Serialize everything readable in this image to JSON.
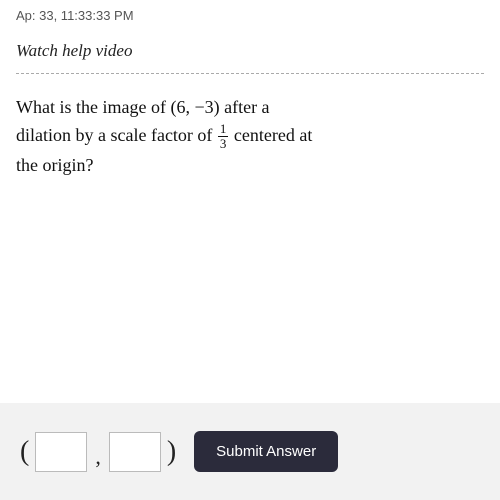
{
  "topbar": {
    "text": "Ap: 33, 11:33:33 PM"
  },
  "watchHelp": {
    "label": "Watch help video"
  },
  "question": {
    "part1": "What is the image of ",
    "point": "(6, −3)",
    "part2": " after a",
    "part3": "dilation by a scale factor of ",
    "fraction": {
      "numerator": "1",
      "denominator": "3"
    },
    "part4": " centered at",
    "part5": "the origin?"
  },
  "answerArea": {
    "leftParen": "(",
    "comma": ",",
    "rightParen": ")",
    "box1Placeholder": "",
    "box2Placeholder": "",
    "submitLabel": "Submit Answer"
  }
}
